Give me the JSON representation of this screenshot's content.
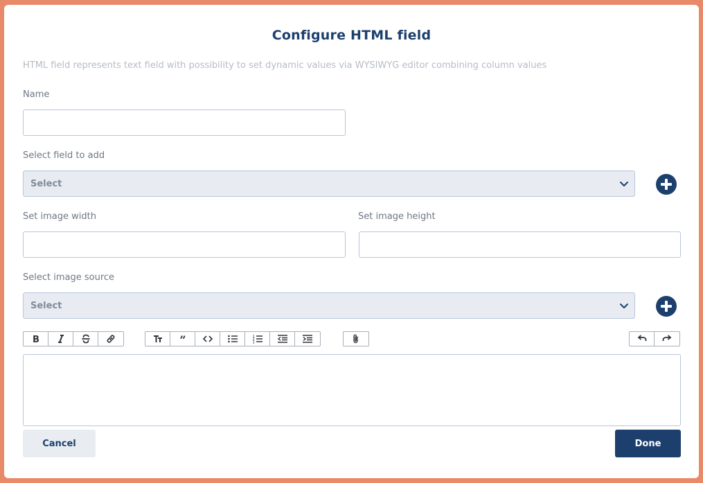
{
  "dialog": {
    "title": "Configure HTML field",
    "description": "HTML field represents text field with possibility to set dynamic values via WYSIWYG editor combining column values"
  },
  "name_field": {
    "label": "Name",
    "value": "",
    "placeholder": ""
  },
  "field_select": {
    "label": "Select field to add",
    "value": "Select",
    "add_icon": "plus-circle-icon"
  },
  "image_width": {
    "label": "Set image width",
    "value": ""
  },
  "image_height": {
    "label": "Set image height",
    "value": ""
  },
  "image_source": {
    "label": "Select image source",
    "value": "Select",
    "add_icon": "plus-circle-icon"
  },
  "toolbar": {
    "groups": [
      [
        "bold-icon",
        "italic-icon",
        "strikethrough-icon",
        "link-icon"
      ],
      [
        "text-size-icon",
        "quote-icon",
        "code-icon",
        "bullet-list-icon",
        "numbered-list-icon",
        "outdent-icon",
        "indent-icon"
      ],
      [
        "attachment-icon"
      ],
      [
        "undo-icon",
        "redo-icon"
      ]
    ]
  },
  "editor": {
    "content": ""
  },
  "actions": {
    "cancel_label": "Cancel",
    "done_label": "Done"
  },
  "colors": {
    "primary": "#1c3f6d",
    "border": "#b7c6dd",
    "select_bg": "#e8ecf2",
    "frame": "#e88a6a"
  }
}
